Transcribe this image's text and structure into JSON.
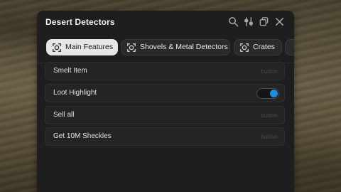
{
  "window": {
    "title": "Desert Detectors"
  },
  "toolbar": {
    "icons": [
      "search-icon",
      "sliders-icon",
      "copy-icon",
      "close-icon"
    ]
  },
  "tabs": [
    {
      "label": "Main Features",
      "icon": "target-icon",
      "active": true
    },
    {
      "label": "Shovels & Metal Detectors",
      "icon": "target-icon",
      "active": false
    },
    {
      "label": "Crates",
      "icon": "target-icon",
      "active": false
    }
  ],
  "items": [
    {
      "label": "Smelt Item",
      "type": "button",
      "hint": "button"
    },
    {
      "label": "Loot Highlight",
      "type": "toggle",
      "enabled": true
    },
    {
      "label": "Sell all",
      "type": "button",
      "hint": "button"
    },
    {
      "label": "Get 10M Sheckles",
      "type": "button",
      "hint": "button"
    }
  ],
  "colors": {
    "window_bg": "#1e1e1e",
    "toggle_on": "#1a8fe0",
    "active_tab_bg": "#e6e6e6"
  }
}
